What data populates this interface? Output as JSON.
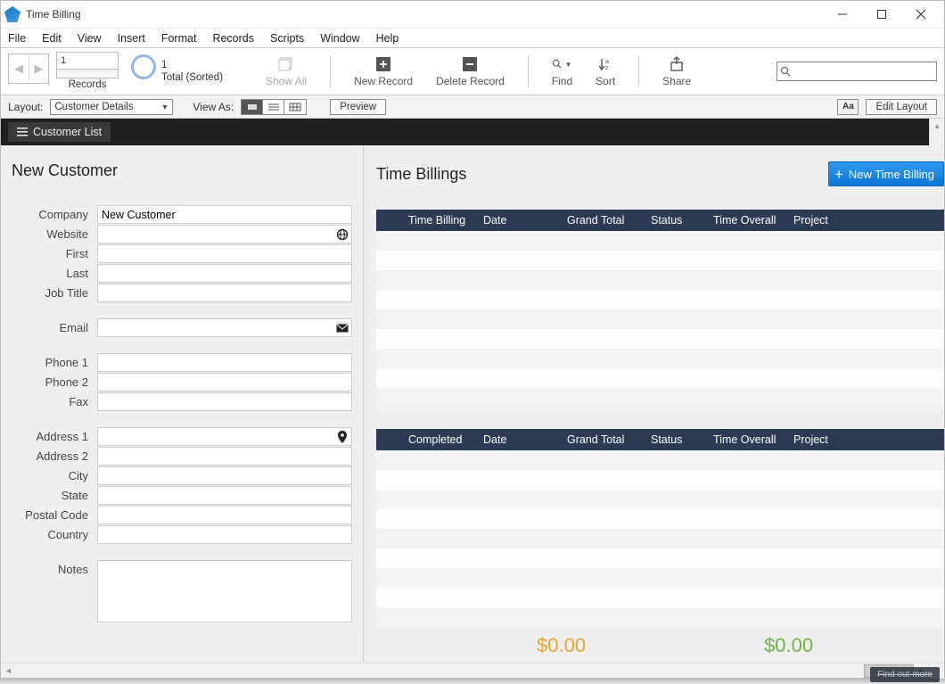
{
  "window": {
    "title": "Time Billing"
  },
  "menus": {
    "file": "File",
    "edit": "Edit",
    "view": "View",
    "insert": "Insert",
    "format": "Format",
    "records": "Records",
    "scripts": "Scripts",
    "window": "Window",
    "help": "Help"
  },
  "records": {
    "current": "1",
    "count": "1",
    "total_label": "Total (Sorted)",
    "records_label": "Records"
  },
  "toolbar": {
    "showall": "Show All",
    "newrecord": "New Record",
    "deleterecord": "Delete Record",
    "find": "Find",
    "sort": "Sort",
    "share": "Share"
  },
  "search": {
    "value": ""
  },
  "layoutbar": {
    "layout_label": "Layout:",
    "current_layout": "Customer Details",
    "viewas": "View As:",
    "preview": "Preview",
    "aa": "Aa",
    "editlayout": "Edit Layout"
  },
  "darkbar": {
    "customer_list": "Customer List"
  },
  "left": {
    "heading": "New Customer",
    "labels": {
      "company": "Company",
      "website": "Website",
      "first": "First",
      "last": "Last",
      "jobtitle": "Job Title",
      "email": "Email",
      "phone1": "Phone 1",
      "phone2": "Phone 2",
      "fax": "Fax",
      "address1": "Address 1",
      "address2": "Address 2",
      "city": "City",
      "state": "State",
      "postal": "Postal Code",
      "country": "Country",
      "notes": "Notes"
    },
    "values": {
      "company": "New Customer",
      "website": "",
      "first": "",
      "last": "",
      "jobtitle": "",
      "email": "",
      "phone1": "",
      "phone2": "",
      "fax": "",
      "address1": "",
      "address2": "",
      "city": "",
      "state": "",
      "postal": "",
      "country": "",
      "notes": ""
    }
  },
  "right": {
    "heading": "Time Billings",
    "newbtn": "New Time Billing",
    "table1_headers": {
      "a": "Time Billing",
      "b": "Date",
      "c": "Grand Total",
      "d": "Status",
      "e": "Time Overall",
      "f": "Project"
    },
    "table2_headers": {
      "a": "Completed",
      "b": "Date",
      "c": "Grand Total",
      "d": "Status",
      "e": "Time Overall",
      "f": "Project"
    },
    "total1": "$0.00",
    "total2": "$0.00"
  },
  "footer": {
    "findout": "Find out more"
  }
}
